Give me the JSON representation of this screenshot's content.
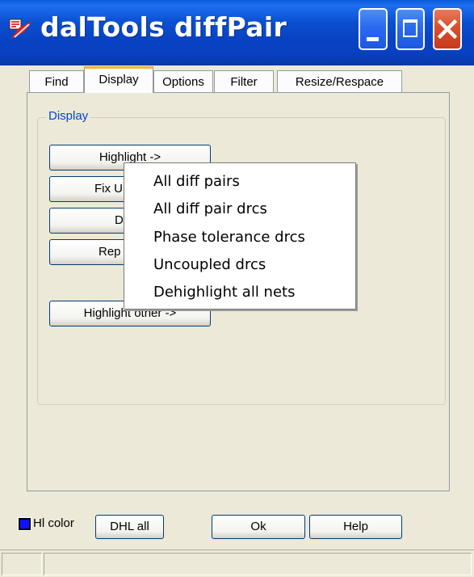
{
  "window": {
    "title": "dalTools diffPair",
    "icon": "app-icon",
    "controls": [
      "minimize-icon",
      "maximize-icon",
      "close-icon"
    ]
  },
  "tabs": [
    {
      "label": "Find",
      "active": false
    },
    {
      "label": "Display",
      "active": true
    },
    {
      "label": "Options",
      "active": false
    },
    {
      "label": "Filter",
      "active": false
    },
    {
      "label": "Resize/Respace",
      "active": false
    }
  ],
  "display_group": {
    "label": "Display",
    "buttons": [
      {
        "label": "Highlight ->"
      },
      {
        "label": "Fix U"
      },
      {
        "label": "Dr"
      },
      {
        "label": "Rep"
      },
      {
        "label": "Highlight other ->"
      }
    ]
  },
  "context_menu": {
    "items": [
      "All diff pairs",
      "All diff pair drcs",
      "Phase tolerance drcs",
      "Uncoupled drcs",
      "Dehighlight all nets"
    ]
  },
  "footer": {
    "hl_color_label": "Hl color",
    "hl_color_value": "#1010ff",
    "dhl_all_label": "DHL all",
    "ok_label": "Ok",
    "help_label": "Help"
  },
  "colors": {
    "titlebar": "#0a4fd0",
    "group_label": "#0046d5",
    "active_tab_accent": "#f4b23c",
    "close_button": "#d9502f"
  }
}
